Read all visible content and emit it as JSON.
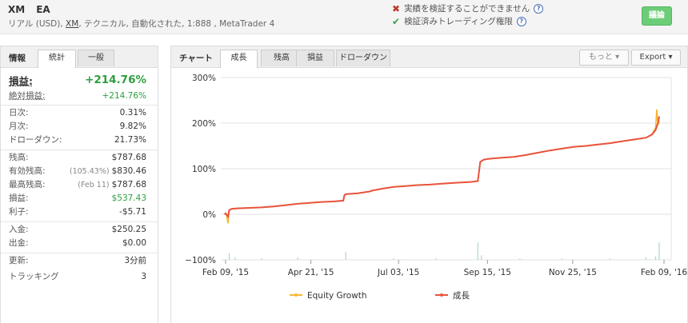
{
  "header": {
    "broker": "XM",
    "name": "EA",
    "subtitle_pre": "リアル (USD), ",
    "subtitle_broker": "XM",
    "subtitle_post": ", テクニカル, 自動化された, 1:888 , MetaTrader 4",
    "verify_track": "実績を検証することができません",
    "verify_trading": "検証済みトレーディング権限",
    "discuss_label": "議論"
  },
  "left": {
    "title": "情報",
    "tabs": [
      "統計",
      "一般"
    ],
    "gain_label": "損益:",
    "gain_value": "+214.76%",
    "abs_gain_label": "絶対損益:",
    "abs_gain_value": "+214.76%",
    "daily_label": "日次:",
    "daily_value": "0.31%",
    "monthly_label": "月次:",
    "monthly_value": "9.82%",
    "drawdown_label": "ドローダウン:",
    "drawdown_value": "21.73%",
    "balance_label": "残高:",
    "balance_value": "$787.68",
    "equity_label": "有効残高:",
    "equity_pct": "(105.43%)",
    "equity_value": "$830.46",
    "highest_label": "最高残高:",
    "highest_date": "(Feb 11)",
    "highest_value": "$787.68",
    "profit_label": "損益:",
    "profit_value": "$537.43",
    "interest_label": "利子:",
    "interest_value": "-$5.71",
    "deposits_label": "入金:",
    "deposits_value": "$250.25",
    "withdrawals_label": "出金:",
    "withdrawals_value": "$0.00",
    "updated_label": "更新:",
    "updated_value": "3分前",
    "tracking_label": "トラッキング",
    "tracking_value": "3"
  },
  "right": {
    "title": "チャート",
    "tabs": [
      "成長",
      "残高",
      "損益",
      "ドローダウン"
    ],
    "more_label": "もっと",
    "export_label": "Export"
  },
  "colors": {
    "growth": "#e8533c",
    "equity": "#f5b731",
    "volume": "#a8dcc0",
    "grid": "#e0e0e0",
    "positive": "#2e9e3e",
    "discuss_bg": "#6ccc78"
  },
  "chart_data": {
    "type": "line",
    "ylim": [
      -100,
      300
    ],
    "yticks": [
      "300%",
      "200%",
      "100%",
      "0%",
      "−100%"
    ],
    "ytick_values": [
      300,
      200,
      100,
      0,
      -100
    ],
    "xticks": [
      "Feb 09, '15",
      "Apr 21, '15",
      "Jul 03, '15",
      "Sep 15, '15",
      "Nov 25, '15",
      "Feb 09, '16"
    ],
    "xtick_values": [
      0,
      71,
      144,
      218,
      289,
      365
    ],
    "xlim": [
      -4,
      371
    ],
    "grid": true,
    "legend_position": "bottom",
    "series": [
      {
        "name": "Equity Growth",
        "points": [
          [
            -1,
            0
          ],
          [
            0,
            2
          ],
          [
            1,
            -5
          ],
          [
            2,
            -20
          ],
          [
            3,
            9
          ],
          [
            5,
            12
          ],
          [
            10,
            13
          ],
          [
            20,
            14
          ],
          [
            30,
            15
          ],
          [
            40,
            17
          ],
          [
            50,
            20
          ],
          [
            60,
            23
          ],
          [
            70,
            25
          ],
          [
            80,
            27
          ],
          [
            90,
            28
          ],
          [
            98,
            30
          ],
          [
            99,
            42
          ],
          [
            100,
            44
          ],
          [
            110,
            46
          ],
          [
            120,
            50
          ],
          [
            122,
            52
          ],
          [
            130,
            56
          ],
          [
            140,
            60
          ],
          [
            150,
            62
          ],
          [
            160,
            64
          ],
          [
            170,
            65
          ],
          [
            180,
            67
          ],
          [
            190,
            69
          ],
          [
            205,
            71
          ],
          [
            210,
            73
          ],
          [
            212,
            115
          ],
          [
            215,
            120
          ],
          [
            220,
            122
          ],
          [
            230,
            124
          ],
          [
            240,
            126
          ],
          [
            250,
            130
          ],
          [
            260,
            135
          ],
          [
            270,
            140
          ],
          [
            280,
            144
          ],
          [
            290,
            148
          ],
          [
            300,
            150
          ],
          [
            310,
            153
          ],
          [
            320,
            156
          ],
          [
            330,
            160
          ],
          [
            340,
            164
          ],
          [
            350,
            168
          ],
          [
            355,
            175
          ],
          [
            358,
            190
          ],
          [
            359,
            230
          ],
          [
            360,
            196
          ],
          [
            361,
            205
          ]
        ]
      },
      {
        "name": "成長",
        "points": [
          [
            -1,
            0
          ],
          [
            0,
            2
          ],
          [
            2,
            -5
          ],
          [
            3,
            9
          ],
          [
            5,
            12
          ],
          [
            10,
            13
          ],
          [
            20,
            14
          ],
          [
            30,
            15
          ],
          [
            40,
            17
          ],
          [
            50,
            20
          ],
          [
            60,
            23
          ],
          [
            70,
            25
          ],
          [
            80,
            27
          ],
          [
            90,
            28
          ],
          [
            98,
            30
          ],
          [
            99,
            42
          ],
          [
            100,
            44
          ],
          [
            110,
            46
          ],
          [
            120,
            50
          ],
          [
            122,
            52
          ],
          [
            130,
            56
          ],
          [
            140,
            60
          ],
          [
            150,
            62
          ],
          [
            160,
            64
          ],
          [
            170,
            65
          ],
          [
            180,
            67
          ],
          [
            190,
            69
          ],
          [
            205,
            71
          ],
          [
            210,
            73
          ],
          [
            212,
            115
          ],
          [
            215,
            120
          ],
          [
            220,
            122
          ],
          [
            230,
            124
          ],
          [
            240,
            126
          ],
          [
            250,
            130
          ],
          [
            260,
            135
          ],
          [
            270,
            140
          ],
          [
            280,
            144
          ],
          [
            290,
            148
          ],
          [
            300,
            150
          ],
          [
            310,
            153
          ],
          [
            320,
            156
          ],
          [
            330,
            160
          ],
          [
            340,
            164
          ],
          [
            350,
            168
          ],
          [
            355,
            175
          ],
          [
            358,
            185
          ],
          [
            360,
            200
          ],
          [
            361,
            214.76
          ]
        ]
      }
    ],
    "volume_bars": [
      [
        3,
        -85
      ],
      [
        8,
        -94
      ],
      [
        30,
        -96
      ],
      [
        60,
        -95
      ],
      [
        100,
        -82
      ],
      [
        140,
        -97
      ],
      [
        175,
        -96
      ],
      [
        210,
        -62
      ],
      [
        213,
        -90
      ],
      [
        245,
        -97
      ],
      [
        280,
        -97
      ],
      [
        320,
        -97
      ],
      [
        350,
        -94
      ],
      [
        358,
        -92
      ],
      [
        361,
        -62
      ]
    ]
  }
}
